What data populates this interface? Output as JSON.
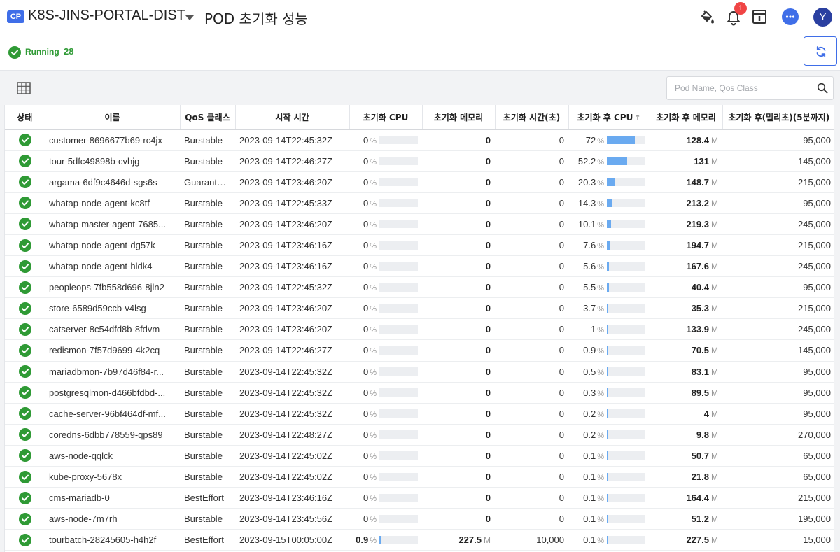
{
  "header": {
    "badge": "CP",
    "project": "K8S-JINS-PORTAL-DIST",
    "page_title": "POD 초기화 성능",
    "notification_count": "1",
    "avatar_letter": "Y"
  },
  "status": {
    "label": "Running",
    "count": "28"
  },
  "search": {
    "placeholder": "Pod Name, Qos Class"
  },
  "colors": {
    "accent": "#3f6ee8",
    "running": "#2f9a35",
    "bar": "#6aaaf0",
    "badge": "#f04545"
  },
  "columns": {
    "state": "상태",
    "name": "이름",
    "qos": "QoS 클래스",
    "start": "시작 시간",
    "init_cpu": "초기화 CPU",
    "init_mem": "초기화 메모리",
    "init_time": "초기화 시간(초)",
    "post_cpu": "초기화 후 CPU",
    "post_cpu_sort": "↑",
    "post_mem": "초기화 후 메모리",
    "post_ms": "초기화 후(밀리초)(5분까지)"
  },
  "units": {
    "percent": "%",
    "mem": "M"
  },
  "rows": [
    {
      "name": "customer-8696677b69-rc4jx",
      "qos": "Burstable",
      "start": "2023-09-14T22:45:32Z",
      "init_cpu": "0",
      "init_mem": "0",
      "init_mem_unit": "",
      "init_time": "0",
      "post_cpu": "72",
      "post_cpu_frac": 0.72,
      "post_mem": "128.4",
      "post_ms": "95,000"
    },
    {
      "name": "tour-5dfc49898b-cvhjg",
      "qos": "Burstable",
      "start": "2023-09-14T22:46:27Z",
      "init_cpu": "0",
      "init_mem": "0",
      "init_mem_unit": "",
      "init_time": "0",
      "post_cpu": "52.2",
      "post_cpu_frac": 0.522,
      "post_mem": "131",
      "post_ms": "145,000"
    },
    {
      "name": "argama-6df9c4646d-sgs6s",
      "qos": "Guaranteed",
      "start": "2023-09-14T23:46:20Z",
      "init_cpu": "0",
      "init_mem": "0",
      "init_mem_unit": "",
      "init_time": "0",
      "post_cpu": "20.3",
      "post_cpu_frac": 0.203,
      "post_mem": "148.7",
      "post_ms": "215,000"
    },
    {
      "name": "whatap-node-agent-kc8tf",
      "qos": "Burstable",
      "start": "2023-09-14T22:45:33Z",
      "init_cpu": "0",
      "init_mem": "0",
      "init_mem_unit": "",
      "init_time": "0",
      "post_cpu": "14.3",
      "post_cpu_frac": 0.143,
      "post_mem": "213.2",
      "post_ms": "95,000"
    },
    {
      "name": "whatap-master-agent-7685...",
      "qos": "Burstable",
      "start": "2023-09-14T23:46:20Z",
      "init_cpu": "0",
      "init_mem": "0",
      "init_mem_unit": "",
      "init_time": "0",
      "post_cpu": "10.1",
      "post_cpu_frac": 0.101,
      "post_mem": "219.3",
      "post_ms": "245,000"
    },
    {
      "name": "whatap-node-agent-dg57k",
      "qos": "Burstable",
      "start": "2023-09-14T23:46:16Z",
      "init_cpu": "0",
      "init_mem": "0",
      "init_mem_unit": "",
      "init_time": "0",
      "post_cpu": "7.6",
      "post_cpu_frac": 0.076,
      "post_mem": "194.7",
      "post_ms": "215,000"
    },
    {
      "name": "whatap-node-agent-hldk4",
      "qos": "Burstable",
      "start": "2023-09-14T23:46:16Z",
      "init_cpu": "0",
      "init_mem": "0",
      "init_mem_unit": "",
      "init_time": "0",
      "post_cpu": "5.6",
      "post_cpu_frac": 0.056,
      "post_mem": "167.6",
      "post_ms": "245,000"
    },
    {
      "name": "peopleops-7fb558d696-8jln2",
      "qos": "Burstable",
      "start": "2023-09-14T22:45:32Z",
      "init_cpu": "0",
      "init_mem": "0",
      "init_mem_unit": "",
      "init_time": "0",
      "post_cpu": "5.5",
      "post_cpu_frac": 0.055,
      "post_mem": "40.4",
      "post_ms": "95,000"
    },
    {
      "name": "store-6589d59ccb-v4lsg",
      "qos": "Burstable",
      "start": "2023-09-14T23:46:20Z",
      "init_cpu": "0",
      "init_mem": "0",
      "init_mem_unit": "",
      "init_time": "0",
      "post_cpu": "3.7",
      "post_cpu_frac": 0.037,
      "post_mem": "35.3",
      "post_ms": "215,000"
    },
    {
      "name": "catserver-8c54dfd8b-8fdvm",
      "qos": "Burstable",
      "start": "2023-09-14T23:46:20Z",
      "init_cpu": "0",
      "init_mem": "0",
      "init_mem_unit": "",
      "init_time": "0",
      "post_cpu": "1",
      "post_cpu_frac": 0.01,
      "post_mem": "133.9",
      "post_ms": "245,000"
    },
    {
      "name": "redismon-7f57d9699-4k2cq",
      "qos": "Burstable",
      "start": "2023-09-14T22:46:27Z",
      "init_cpu": "0",
      "init_mem": "0",
      "init_mem_unit": "",
      "init_time": "0",
      "post_cpu": "0.9",
      "post_cpu_frac": 0.009,
      "post_mem": "70.5",
      "post_ms": "145,000"
    },
    {
      "name": "mariadbmon-7b97d46f84-r...",
      "qos": "Burstable",
      "start": "2023-09-14T22:45:32Z",
      "init_cpu": "0",
      "init_mem": "0",
      "init_mem_unit": "",
      "init_time": "0",
      "post_cpu": "0.5",
      "post_cpu_frac": 0.005,
      "post_mem": "83.1",
      "post_ms": "95,000"
    },
    {
      "name": "postgresqlmon-d466bfdbd-...",
      "qos": "Burstable",
      "start": "2023-09-14T22:45:32Z",
      "init_cpu": "0",
      "init_mem": "0",
      "init_mem_unit": "",
      "init_time": "0",
      "post_cpu": "0.3",
      "post_cpu_frac": 0.003,
      "post_mem": "89.5",
      "post_ms": "95,000"
    },
    {
      "name": "cache-server-96bf464df-mf...",
      "qos": "Burstable",
      "start": "2023-09-14T22:45:32Z",
      "init_cpu": "0",
      "init_mem": "0",
      "init_mem_unit": "",
      "init_time": "0",
      "post_cpu": "0.2",
      "post_cpu_frac": 0.002,
      "post_mem": "4",
      "post_ms": "95,000"
    },
    {
      "name": "coredns-6dbb778559-qps89",
      "qos": "Burstable",
      "start": "2023-09-14T22:48:27Z",
      "init_cpu": "0",
      "init_mem": "0",
      "init_mem_unit": "",
      "init_time": "0",
      "post_cpu": "0.2",
      "post_cpu_frac": 0.002,
      "post_mem": "9.8",
      "post_ms": "270,000"
    },
    {
      "name": "aws-node-qqlck",
      "qos": "Burstable",
      "start": "2023-09-14T22:45:02Z",
      "init_cpu": "0",
      "init_mem": "0",
      "init_mem_unit": "",
      "init_time": "0",
      "post_cpu": "0.1",
      "post_cpu_frac": 0.001,
      "post_mem": "50.7",
      "post_ms": "65,000"
    },
    {
      "name": "kube-proxy-5678x",
      "qos": "Burstable",
      "start": "2023-09-14T22:45:02Z",
      "init_cpu": "0",
      "init_mem": "0",
      "init_mem_unit": "",
      "init_time": "0",
      "post_cpu": "0.1",
      "post_cpu_frac": 0.001,
      "post_mem": "21.8",
      "post_ms": "65,000"
    },
    {
      "name": "cms-mariadb-0",
      "qos": "BestEffort",
      "start": "2023-09-14T23:46:16Z",
      "init_cpu": "0",
      "init_mem": "0",
      "init_mem_unit": "",
      "init_time": "0",
      "post_cpu": "0.1",
      "post_cpu_frac": 0.001,
      "post_mem": "164.4",
      "post_ms": "215,000"
    },
    {
      "name": "aws-node-7m7rh",
      "qos": "Burstable",
      "start": "2023-09-14T23:45:56Z",
      "init_cpu": "0",
      "init_mem": "0",
      "init_mem_unit": "",
      "init_time": "0",
      "post_cpu": "0.1",
      "post_cpu_frac": 0.001,
      "post_mem": "51.2",
      "post_ms": "195,000"
    },
    {
      "name": "tourbatch-28245605-h4h2f",
      "qos": "BestEffort",
      "start": "2023-09-15T00:05:00Z",
      "init_cpu": "0.9",
      "init_cpu_frac": 0.009,
      "init_mem": "227.5",
      "init_mem_unit": "M",
      "init_time": "10,000",
      "post_cpu": "0.1",
      "post_cpu_frac": 0.001,
      "post_mem": "227.5",
      "post_ms": "15,000"
    }
  ]
}
